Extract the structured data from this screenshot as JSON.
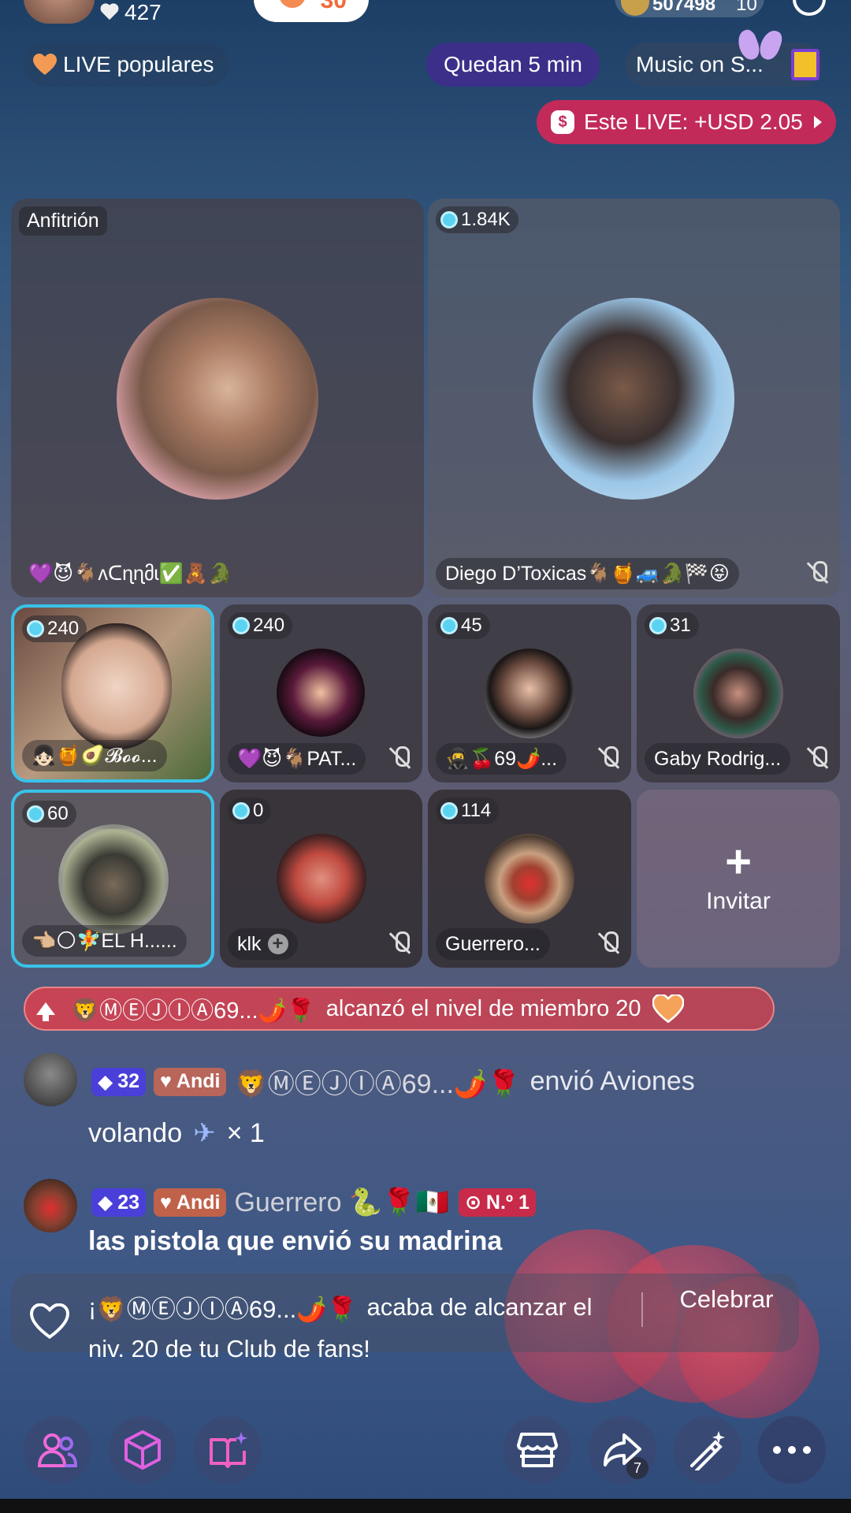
{
  "top": {
    "likes": "427",
    "button_count": "30",
    "coins": "507498",
    "coins_extra": "10"
  },
  "pills": {
    "popular": "LIVE populares",
    "remaining": "Quedan 5 min",
    "music": "Music on S...",
    "earnings": "Este LIVE: +USD 2.05"
  },
  "host": {
    "tag": "Anfitrión",
    "name": "💜😈🐐ʌᑕɳɳმɩ✅🧸🐊"
  },
  "guest_main": {
    "score": "1.84K",
    "name": "Diego D’Toxicas🐐🍯🚙🐊🏁😝"
  },
  "seats": [
    {
      "score": "240",
      "name": "👧🏻🍯🥑𝓑𝓸𝓸..."
    },
    {
      "score": "240",
      "name": "💜😈🐐PAT..."
    },
    {
      "score": "45",
      "name": "🥷🍒69🌶️..."
    },
    {
      "score": "31",
      "name": "Gaby Rodrig..."
    },
    {
      "score": "60",
      "name": "👈🏼🌕🧚EL H......"
    },
    {
      "score": "0",
      "name": "klk"
    },
    {
      "score": "114",
      "name": "Guerrero..."
    }
  ],
  "invite": "Invitar",
  "banner": {
    "name": "🦁ⓂⒺⒿⒾⒶ69...🌶️🌹",
    "text": "alcanzó el nivel de miembro 20"
  },
  "chat": [
    {
      "level": "32",
      "club": "Andi",
      "user": "🦁ⓂⒺⒿⒾⒶ69...🌶️🌹",
      "msg1": "envió Aviones",
      "msg2": "volando",
      "qty": "× 1"
    },
    {
      "level": "23",
      "club": "Andi",
      "user": "Guerrero 🐍🌹🇲🇽",
      "rank": "N.º 1",
      "msg1": "las pistola que envió su madrina"
    }
  ],
  "notice": {
    "line1_prefix": "¡",
    "name": "🦁ⓂⒺⒿⒾⒶ69...🌶️🌹",
    "line1_rest": "acaba de alcanzar el",
    "line2": "niv. 20 de tu Club de fans!",
    "celebrate": "Celebrar"
  },
  "bottom": {
    "share_count": "7"
  },
  "colors": {
    "accent_pink": "#c22a5a",
    "seat_highlight": "#39c2e8",
    "level_badge": "#4a3fd8"
  }
}
